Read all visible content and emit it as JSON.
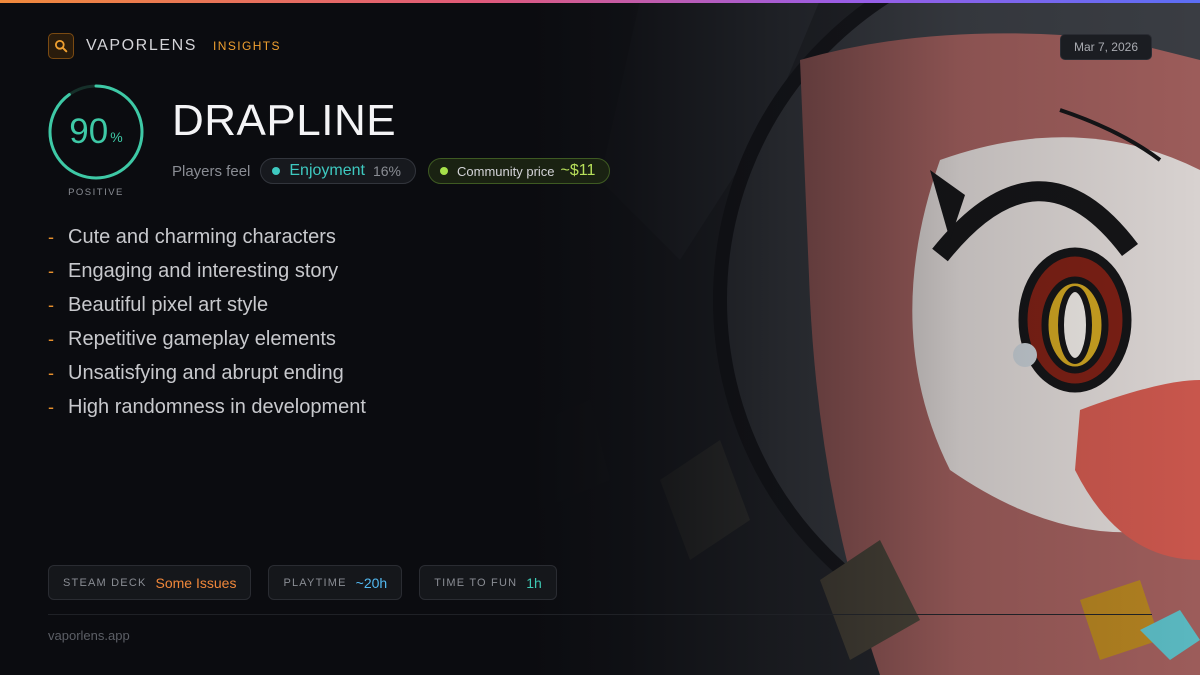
{
  "brand": {
    "name": "VAPORLENS",
    "tag": "INSIGHTS",
    "icon": "search-icon",
    "accent": "#f0a030"
  },
  "date": "Mar 7, 2026",
  "score": {
    "value": "90",
    "unit": "%",
    "label": "POSITIVE",
    "fraction": 0.9,
    "color": "#3ec9a6"
  },
  "game": {
    "title": "DRAPLINE"
  },
  "feel": {
    "label": "Players feel",
    "emotion": {
      "name": "Enjoyment",
      "percent": "16%"
    },
    "price": {
      "label": "Community price",
      "value": "~$11"
    }
  },
  "points": [
    "Cute and charming characters",
    "Engaging and interesting story",
    "Beautiful pixel art style",
    "Repetitive gameplay elements",
    "Unsatisfying and abrupt ending",
    "High randomness in development"
  ],
  "stats": {
    "steam_deck": {
      "label": "STEAM DECK",
      "value": "Some Issues"
    },
    "playtime": {
      "label": "PLAYTIME",
      "value": "~20h"
    },
    "time_to_fun": {
      "label": "TIME TO FUN",
      "value": "1h"
    }
  },
  "footer": "vaporlens.app"
}
